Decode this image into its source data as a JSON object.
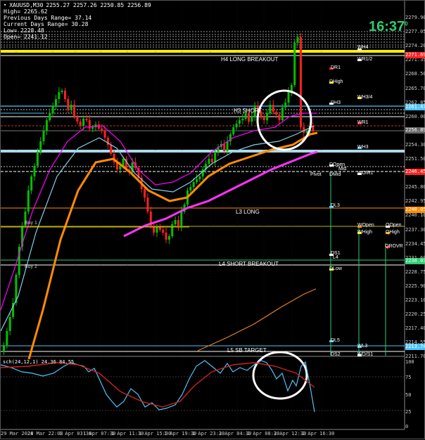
{
  "window": {
    "symbol": "XAUUSD,M30",
    "ohlc": "2255.27 2257.26 2250.85 2256.89",
    "info_lines": [
      "High= 2265.62",
      "Previous Days Range= 37.14",
      "Current Days Range= 30.28",
      "Low= 2228.48",
      "Open= 2241.12"
    ],
    "clock": "16:37",
    "clock_sup": "0",
    "oscillator_title": "sch(24,12,1) 24.36 84.55"
  },
  "colors": {
    "bull": "#00c000",
    "bear": "#ff2020",
    "ma_fast": "#ff00ff",
    "ma_slow": "#ff8c00",
    "ma_light": "#87ceeb",
    "ma_magenta_bold": "#ff33ff",
    "yellow": "#ffee00",
    "cyan": "#4fc3f7",
    "green_text": "#2ecc71",
    "osc_line": "#4fc3f7",
    "osc_signal": "#d02020"
  },
  "price_axis": {
    "ticks": [
      "2279.90",
      "2277.05",
      "2274.20",
      "2271.35",
      "2268.50",
      "2265.70",
      "2262.85",
      "2260.00",
      "2257.15",
      "2254.30",
      "2251.50",
      "2248.65",
      "2245.80",
      "2242.95",
      "2240.10",
      "2237.30",
      "2234.45",
      "2231.60",
      "2228.75",
      "2225.90",
      "2223.10",
      "2220.25",
      "2217.40",
      "2214.55",
      "2211.70"
    ],
    "boxes": [
      {
        "label": "2271.69",
        "color": "#ff2020"
      },
      {
        "label": "2261.47",
        "color": "#4fc3f7"
      },
      {
        "label": "2256.89",
        "color": "#666666"
      },
      {
        "label": "2246.45",
        "color": "#ff2020"
      },
      {
        "label": "2240.05",
        "color": "#ff8c00"
      },
      {
        "label": "2230.03",
        "color": "#2ecc71"
      },
      {
        "label": "2213.74",
        "color": "#4fc3f7"
      }
    ]
  },
  "time_axis": [
    "29 Mar 2024",
    "28 Mar 22:00",
    "1 Apr 03:30",
    "1 Apr 07:30",
    "1 Apr 11:30",
    "1 Apr 15:30",
    "1 Apr 19:30",
    "1 Apr 23:30",
    "2 Apr 04:30",
    "2 Apr 08:30",
    "2 Apr 12:30",
    "2 Apr 16:30"
  ],
  "osc_axis": [
    "100",
    "75",
    "50",
    "25",
    "0"
  ],
  "levels": {
    "h4": "H4 LONG BREAKOUT",
    "h3": "H3 SHORT",
    "l3": "L3 LONG",
    "l4": "L4 SHORT BREAKOUT",
    "l5": "L5 SB TARGET",
    "wh4": "WH4",
    "wr12": "WR1/2",
    "dr1": "DR1",
    "dhigh": "DHigh",
    "wh34": "WH3/4",
    "dh3": "DH3",
    "wr1": "WR1",
    "wh3": "WH3",
    "dopen": "DOpen",
    "mid": "Mid",
    "pivot": "Pivot",
    "dmid": "DMid",
    "wdr1": "WD/R1",
    "dl3": "DL3",
    "wopen": "WOpen",
    "qopen": "QOpen",
    "whigh": "WHigh",
    "qhigh": "QHigh",
    "qrov": "QROVR",
    "ds1": "DS1",
    "l4b": "L4",
    "dlow": "DLow",
    "dl5": "DL5",
    "wl3": "WL3",
    "ds2": "DS2",
    "wds1": "WD/S1",
    "left_buy_1": "Buy 1",
    "left_buy_2": "Buy 2"
  }
}
